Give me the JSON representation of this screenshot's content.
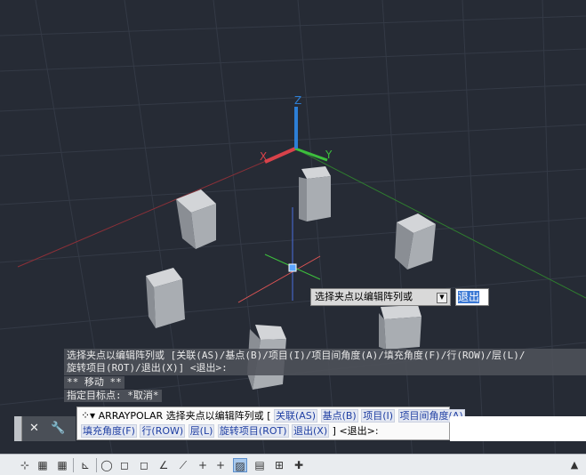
{
  "ucs": {
    "x_label": "X",
    "y_label": "Y",
    "z_label": "Z"
  },
  "dynamic_input": {
    "prompt": "选择夹点以编辑阵列或",
    "value": "退出"
  },
  "command_history": {
    "line1": "选择夹点以编辑阵列或 [关联(AS)/基点(B)/项目(I)/项目间角度(A)/填充角度(F)/行(ROW)/层(L)/",
    "line2": "旋转项目(ROT)/退出(X)] <退出>:",
    "line3": "** 移动 **",
    "line4": "指定目标点: *取消*"
  },
  "command_line": {
    "close_label": "✕",
    "settings_label": "🔧",
    "command": "ARRAYPOLAR",
    "prompt": "选择夹点以编辑阵列或",
    "open_bracket": "[",
    "options_row1": [
      "关联(AS)",
      "基点(B)",
      "项目(I)",
      "项目间角度(A)"
    ],
    "options_row2": [
      "填充角度(F)",
      "行(ROW)",
      "层(L)",
      "旋转项目(ROT)",
      "退出(X)"
    ],
    "close_bracket": "]",
    "default": "<退出>:"
  },
  "status_bar": {
    "buttons": [
      "⊹",
      "▦",
      "▦",
      "⊾",
      "◯",
      "◻",
      "∠",
      "⟋",
      "+",
      "▨",
      "▤",
      "⊞",
      "✚"
    ]
  },
  "colors": {
    "background": "#262b35",
    "x_axis": "#d8424a",
    "y_axis": "#3dbf3d",
    "z_axis": "#2d7fd6"
  }
}
